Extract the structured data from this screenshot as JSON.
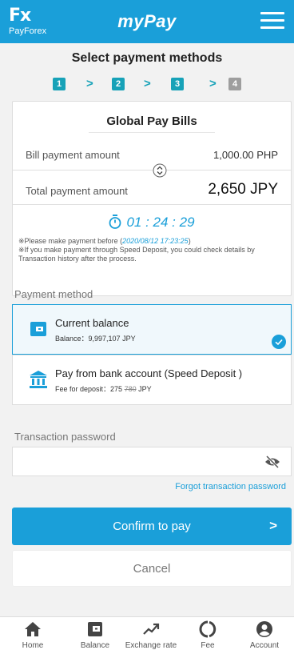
{
  "header": {
    "logo_mark": "Fx",
    "logo_brand": "PayForex",
    "title": "myPay"
  },
  "page_title": "Select payment methods",
  "steps": [
    {
      "label": "1",
      "active": true
    },
    {
      "label": "2",
      "active": true
    },
    {
      "label": "3",
      "active": true
    },
    {
      "label": "4",
      "active": false
    }
  ],
  "step_arrow": ">",
  "bill": {
    "title": "Global Pay Bills",
    "bill_amount_label": "Bill payment amount",
    "bill_amount_value": "1,000.00 PHP",
    "total_label": "Total payment amount",
    "total_value": "2,650 JPY",
    "timer": "01 : 24 : 29",
    "note1_prefix": "※Please make payment before  (",
    "note1_date": "2020/08/12 17:23:25",
    "note1_suffix": ")",
    "note2": "※If you make payment through Speed Deposit, you could check details by Transaction history after the process."
  },
  "payment_method": {
    "label": "Payment method",
    "options": [
      {
        "name": "Current balance",
        "sub": "Balance：9,997,107 JPY",
        "selected": true
      },
      {
        "name": "Pay from bank account (Speed Deposit )",
        "sub_prefix": "Fee for deposit：275 ",
        "sub_strike": "780",
        "sub_suffix": " JPY",
        "selected": false
      }
    ]
  },
  "password": {
    "label": "Transaction password",
    "value": "",
    "forgot": "Forgot transaction password"
  },
  "buttons": {
    "confirm": "Confirm to pay",
    "confirm_arrow": ">",
    "cancel": "Cancel"
  },
  "tabs": [
    {
      "label": "Home",
      "icon": "home-icon"
    },
    {
      "label": "Balance",
      "icon": "wallet-icon"
    },
    {
      "label": "Exchange rate",
      "icon": "trend-icon"
    },
    {
      "label": "Fee",
      "icon": "fee-icon"
    },
    {
      "label": "Account",
      "icon": "account-icon"
    }
  ],
  "colors": {
    "accent": "#1a9fd9",
    "step": "#17a2b8",
    "step_off": "#9e9e9e",
    "background": "#f2f2f2"
  }
}
